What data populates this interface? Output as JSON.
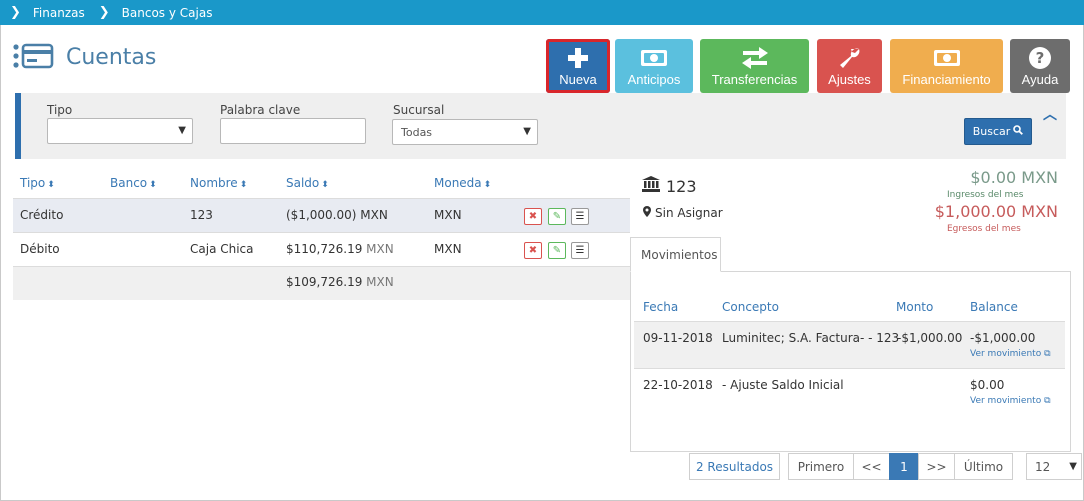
{
  "breadcrumb": [
    "Finanzas",
    "Bancos y Cajas"
  ],
  "page": {
    "title": "Cuentas"
  },
  "toolbar": {
    "nueva": "Nueva",
    "anticipos": "Anticipos",
    "transferencias": "Transferencias",
    "ajustes": "Ajustes",
    "financiamiento": "Financiamiento",
    "ayuda": "Ayuda"
  },
  "filters": {
    "tipo_label": "Tipo",
    "tipo_value": "",
    "palabra_label": "Palabra clave",
    "palabra_value": "",
    "sucursal_label": "Sucursal",
    "sucursal_value": "Todas",
    "buscar": "Buscar"
  },
  "accounts_table": {
    "headers": [
      "Tipo",
      "Banco",
      "Nombre",
      "Saldo",
      "Moneda"
    ],
    "rows": [
      {
        "tipo": "Crédito",
        "banco": "",
        "nombre": "123",
        "saldo": "($1,000.00) MXN",
        "moneda": "MXN"
      },
      {
        "tipo": "Débito",
        "banco": "",
        "nombre": "Caja Chica",
        "saldo_amount": "$110,726.19",
        "saldo_currency": "MXN",
        "moneda": "MXN"
      }
    ],
    "total_amount": "$109,726.19",
    "total_currency": "MXN"
  },
  "account_detail": {
    "name": "123",
    "branch": "Sin Asignar",
    "ingresos_amount": "$0.00 MXN",
    "ingresos_label": "Ingresos del mes",
    "egresos_amount": "$1,000.00 MXN",
    "egresos_label": "Egresos del mes",
    "tab": "Movimientos"
  },
  "movements": {
    "headers": [
      "Fecha",
      "Concepto",
      "Monto",
      "Balance"
    ],
    "rows": [
      {
        "fecha": "09-11-2018",
        "concepto": "Luminitec; S.A. Factura- - 123",
        "monto": "-$1,000.00",
        "balance": "-$1,000.00",
        "link": "Ver movimiento"
      },
      {
        "fecha": "22-10-2018",
        "concepto": "- Ajuste Saldo Inicial",
        "monto": "",
        "balance": "$0.00",
        "link": "Ver movimiento"
      }
    ]
  },
  "pagination": {
    "results": "2 Resultados",
    "first": "Primero",
    "prev": "<<",
    "current": "1",
    "next": ">>",
    "last": "Último",
    "per_page": "12"
  },
  "colors": {
    "topbar": "#1a98c9",
    "primary": "#2e6fae",
    "info": "#5bc0de",
    "success": "#5cb85c",
    "danger": "#d9534f",
    "warning": "#f0ad4e",
    "dark": "#6d6d6d",
    "highlight_outline": "#d9262b"
  }
}
